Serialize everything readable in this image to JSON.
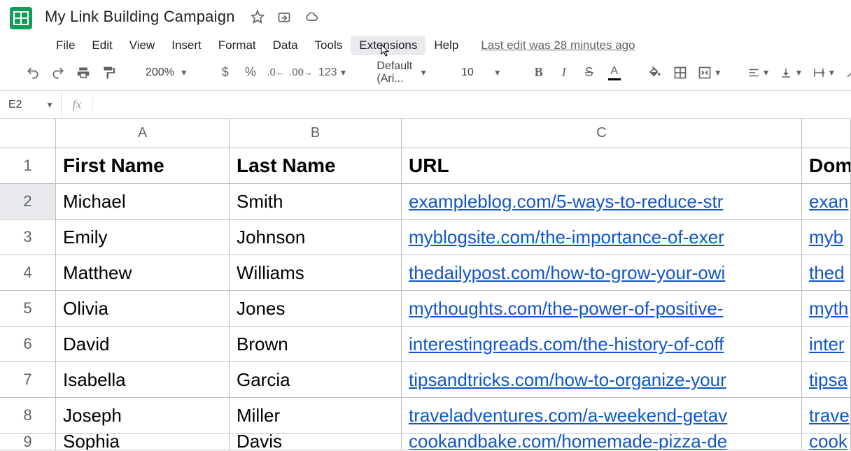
{
  "title": "My Link Building Campaign",
  "menu": {
    "file": "File",
    "edit": "Edit",
    "view": "View",
    "insert": "Insert",
    "format": "Format",
    "data": "Data",
    "tools": "Tools",
    "extensions": "Extensions",
    "help": "Help",
    "lastEdit": "Last edit was 28 minutes ago"
  },
  "toolbar": {
    "zoom": "200%",
    "numFormat": "123",
    "font": "Default (Ari...",
    "fontSize": "10"
  },
  "nameBox": "E2",
  "columns": {
    "A": "A",
    "B": "B",
    "C": "C"
  },
  "headers": {
    "first": "First Name",
    "last": "Last Name",
    "url": "URL",
    "domain": "Dom"
  },
  "rows": [
    {
      "n": "1"
    },
    {
      "n": "2",
      "first": "Michael",
      "last": "Smith",
      "url": "exampleblog.com/5-ways-to-reduce-str",
      "dom": "exan"
    },
    {
      "n": "3",
      "first": "Emily",
      "last": "Johnson",
      "url": "myblogsite.com/the-importance-of-exer",
      "dom": "myb"
    },
    {
      "n": "4",
      "first": "Matthew",
      "last": "Williams",
      "url": "thedailypost.com/how-to-grow-your-owi",
      "dom": "thed"
    },
    {
      "n": "5",
      "first": "Olivia",
      "last": "Jones",
      "url": "mythoughts.com/the-power-of-positive-",
      "dom": "myth"
    },
    {
      "n": "6",
      "first": "David",
      "last": "Brown",
      "url": "interestingreads.com/the-history-of-coff",
      "dom": "inter"
    },
    {
      "n": "7",
      "first": "Isabella",
      "last": "Garcia",
      "url": "tipsandtricks.com/how-to-organize-your",
      "dom": "tipsa"
    },
    {
      "n": "8",
      "first": "Joseph",
      "last": "Miller",
      "url": "traveladventures.com/a-weekend-getav",
      "dom": "trave"
    },
    {
      "n": "9",
      "first": "Sophia",
      "last": "Davis",
      "url": "cookandbake.com/homemade-pizza-de",
      "dom": "cook"
    }
  ]
}
